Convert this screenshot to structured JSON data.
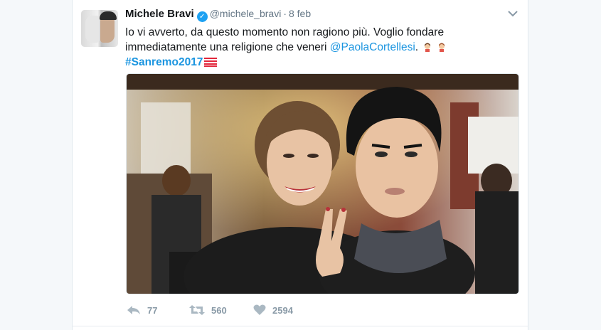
{
  "tweet": {
    "author_name": "Michele Bravi",
    "author_handle": "@michele_bravi",
    "separator": "·",
    "date": "8 feb",
    "text_line1": "Io vi avverto, da questo momento non ragiono più. Voglio fondare",
    "text_line2": "immediatamente una religione che veneri ",
    "mention": "@PaolaCortellesi",
    "text_after_mention": ".",
    "hashtag": "#Sanremo2017",
    "verified": true,
    "icons": [
      "verified-badge-icon",
      "chevron-down-icon",
      "woman-emoji-icon",
      "sanremo-flag-icon"
    ]
  },
  "actions": {
    "reply_count": "77",
    "retweet_count": "560",
    "like_count": "2594",
    "icons": [
      "reply-icon",
      "retweet-icon",
      "heart-icon"
    ]
  },
  "colors": {
    "link": "#1b95e0",
    "verified": "#1da1f2",
    "muted": "#657786",
    "action": "#8899a6",
    "background": "#f5f8fa"
  }
}
